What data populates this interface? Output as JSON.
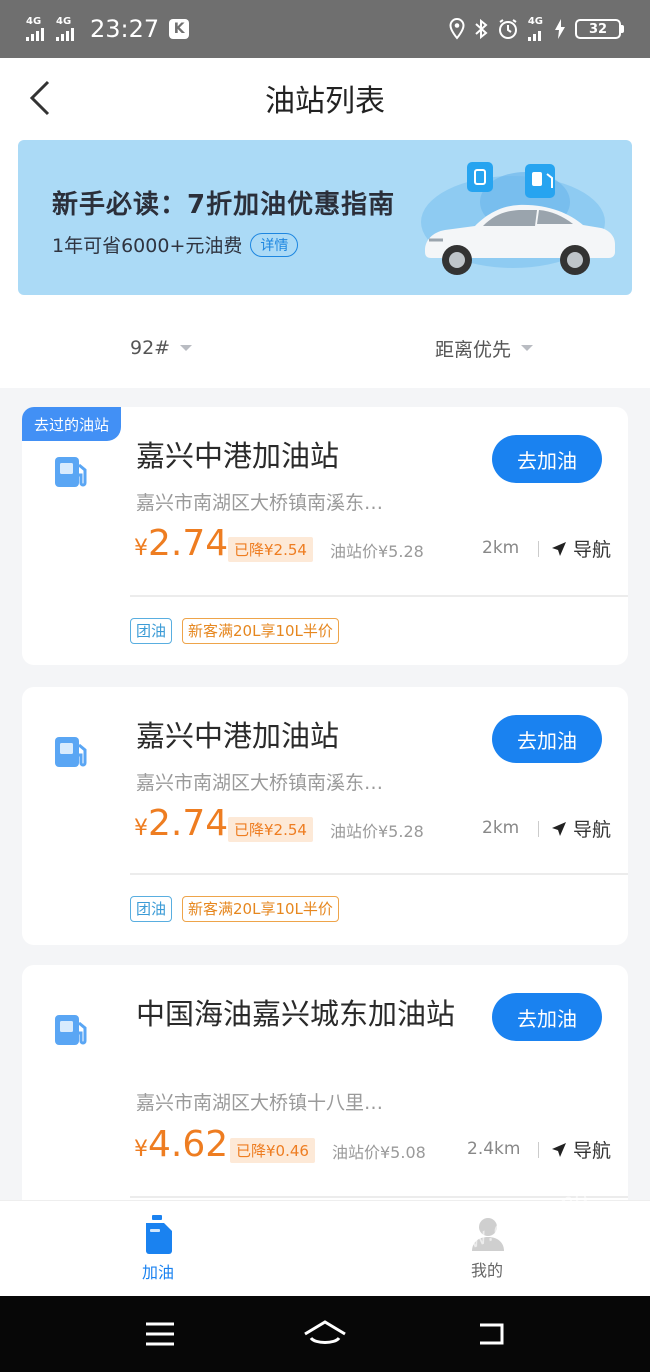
{
  "status_bar": {
    "net1": "4G",
    "net2": "4G",
    "time": "23:27",
    "k_badge": "K",
    "net3": "4G",
    "battery": "32"
  },
  "header": {
    "title": "油站列表",
    "back_icon": "chevron-left-icon"
  },
  "banner": {
    "title": "新手必读：7折加油优惠指南",
    "subtitle": "1年可省6000+元油费",
    "detail_label": "详情"
  },
  "filters": {
    "fuel_type": "92#",
    "sort": "距离优先"
  },
  "stations": [
    {
      "visited_tag": "去过的油站",
      "name": "嘉兴中港加油站",
      "address": "嘉兴市南湖区大桥镇南溪东…",
      "price": "2.74",
      "currency": "¥",
      "drop": "已降¥2.54",
      "station_price": "油站价¥5.28",
      "distance": "2km",
      "nav_label": "导航",
      "go_label": "去加油",
      "tags": [
        "团油",
        "新客满20L享10L半价"
      ]
    },
    {
      "name": "嘉兴中港加油站",
      "address": "嘉兴市南湖区大桥镇南溪东…",
      "price": "2.74",
      "currency": "¥",
      "drop": "已降¥2.54",
      "station_price": "油站价¥5.28",
      "distance": "2km",
      "nav_label": "导航",
      "go_label": "去加油",
      "tags": [
        "团油",
        "新客满20L享10L半价"
      ]
    },
    {
      "name": "中国海油嘉兴城东加油站",
      "address": "嘉兴市南湖区大桥镇十八里…",
      "price": "4.62",
      "currency": "¥",
      "drop": "已降¥0.46",
      "station_price": "油站价¥5.08",
      "distance": "2.4km",
      "nav_label": "导航",
      "go_label": "去加油"
    }
  ],
  "tabbar": {
    "refuel": "加油",
    "mine": "我的"
  },
  "watermark": "www.duchang",
  "colors": {
    "accent": "#1a82f0",
    "price": "#ee7d21",
    "banner_bg": "#abdaf6"
  }
}
